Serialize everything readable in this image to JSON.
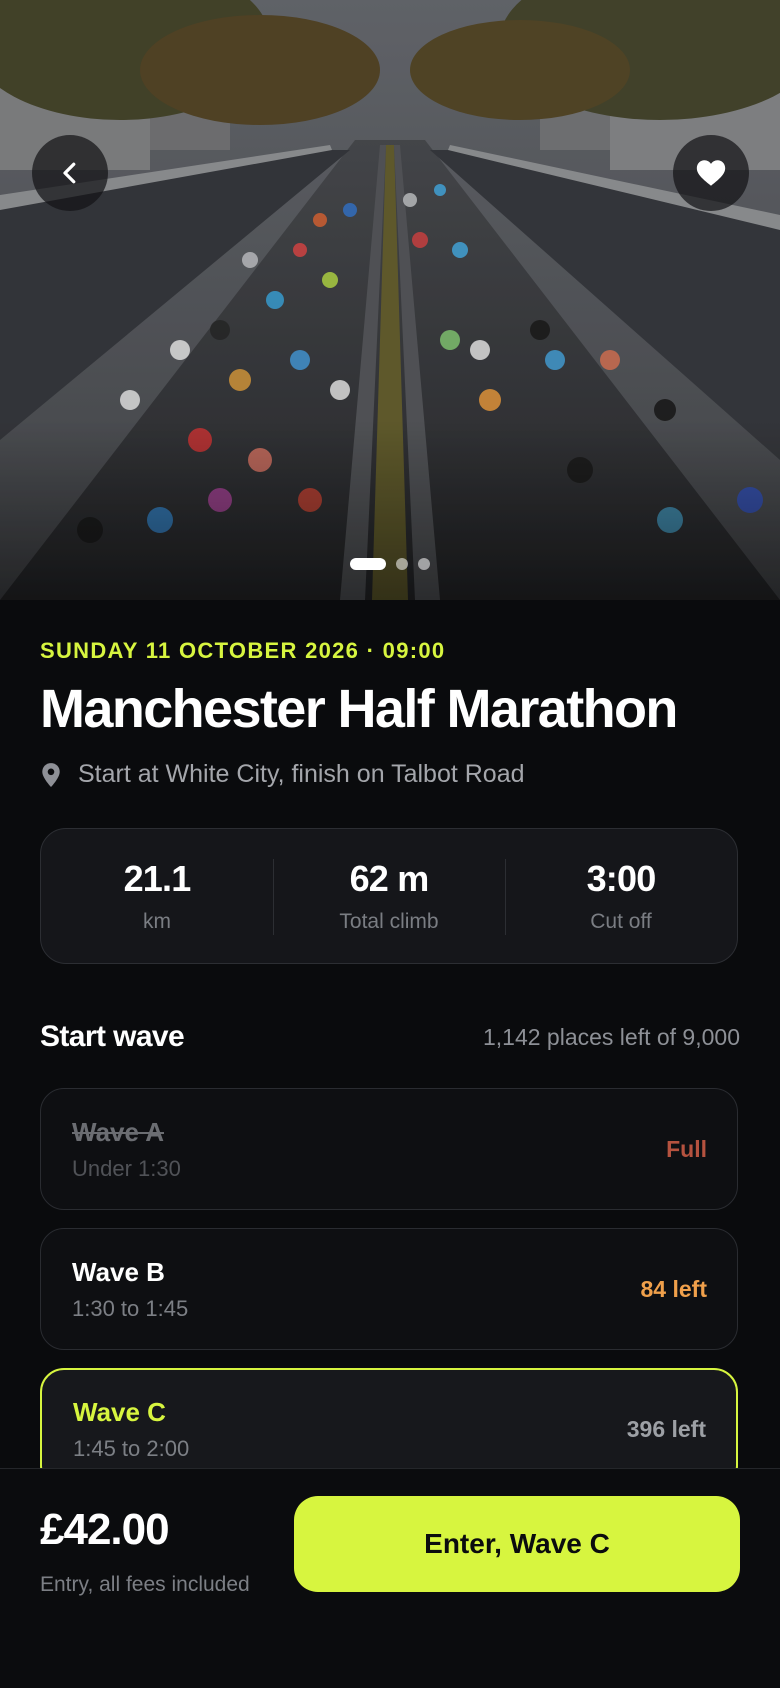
{
  "hero": {
    "back_icon": "chevron-left-icon",
    "favorite_icon": "heart-icon",
    "carousel": {
      "count": 3,
      "active_index": 0
    }
  },
  "event": {
    "datetime": "SUNDAY 11 OCTOBER 2026 · 09:00",
    "title": "Manchester Half Marathon",
    "location_icon": "location-pin-icon",
    "location": "Start at White City, finish on Talbot Road"
  },
  "stats": [
    {
      "value": "21.1",
      "label": "km"
    },
    {
      "value": "62 m",
      "label": "Total climb"
    },
    {
      "value": "3:00",
      "label": "Cut off"
    }
  ],
  "waves_section": {
    "title": "Start wave",
    "places": "1,142 places left of 9,000"
  },
  "waves": [
    {
      "name": "Wave A",
      "range": "Under 1:30",
      "availability": "Full"
    },
    {
      "name": "Wave B",
      "range": "1:30 to 1:45",
      "availability": "84 left"
    },
    {
      "name": "Wave C",
      "range": "1:45 to 2:00",
      "availability": "396 left"
    }
  ],
  "checkout": {
    "price": "£42.00",
    "price_note": "Entry, all fees included",
    "cta_label": "Enter, Wave C"
  },
  "colors": {
    "accent": "#d7f53f",
    "background": "#0a0b0d",
    "full": "#b5523f",
    "limited": "#f0a04b"
  }
}
